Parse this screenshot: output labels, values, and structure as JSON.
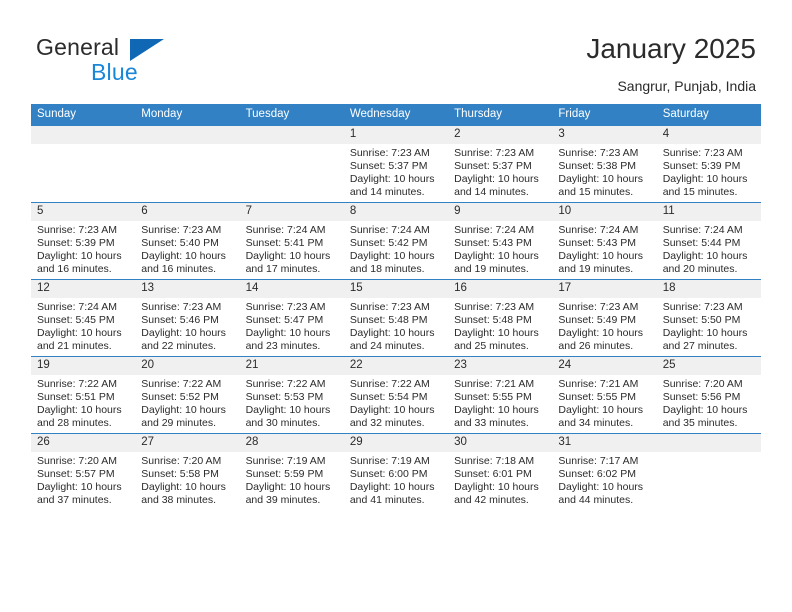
{
  "brand": {
    "name_part1": "General",
    "name_part2": "Blue",
    "accent_color": "#1a86d8",
    "triangle_color": "#1068b5"
  },
  "header": {
    "title": "January 2025",
    "subtitle": "Sangrur, Punjab, India"
  },
  "calendar": {
    "header_bg": "#3281c4",
    "daynum_bg": "#f0f0f0",
    "weekdays": [
      "Sunday",
      "Monday",
      "Tuesday",
      "Wednesday",
      "Thursday",
      "Friday",
      "Saturday"
    ],
    "labels": {
      "sunrise": "Sunrise:",
      "sunset": "Sunset:",
      "daylight": "Daylight:"
    },
    "weeks": [
      [
        {
          "day": "",
          "empty": true
        },
        {
          "day": "",
          "empty": true
        },
        {
          "day": "",
          "empty": true
        },
        {
          "day": "1",
          "sunrise": "Sunrise: 7:23 AM",
          "sunset": "Sunset: 5:37 PM",
          "daylight_line1": "Daylight: 10 hours",
          "daylight_line2": "and 14 minutes."
        },
        {
          "day": "2",
          "sunrise": "Sunrise: 7:23 AM",
          "sunset": "Sunset: 5:37 PM",
          "daylight_line1": "Daylight: 10 hours",
          "daylight_line2": "and 14 minutes."
        },
        {
          "day": "3",
          "sunrise": "Sunrise: 7:23 AM",
          "sunset": "Sunset: 5:38 PM",
          "daylight_line1": "Daylight: 10 hours",
          "daylight_line2": "and 15 minutes."
        },
        {
          "day": "4",
          "sunrise": "Sunrise: 7:23 AM",
          "sunset": "Sunset: 5:39 PM",
          "daylight_line1": "Daylight: 10 hours",
          "daylight_line2": "and 15 minutes."
        }
      ],
      [
        {
          "day": "5",
          "sunrise": "Sunrise: 7:23 AM",
          "sunset": "Sunset: 5:39 PM",
          "daylight_line1": "Daylight: 10 hours",
          "daylight_line2": "and 16 minutes."
        },
        {
          "day": "6",
          "sunrise": "Sunrise: 7:23 AM",
          "sunset": "Sunset: 5:40 PM",
          "daylight_line1": "Daylight: 10 hours",
          "daylight_line2": "and 16 minutes."
        },
        {
          "day": "7",
          "sunrise": "Sunrise: 7:24 AM",
          "sunset": "Sunset: 5:41 PM",
          "daylight_line1": "Daylight: 10 hours",
          "daylight_line2": "and 17 minutes."
        },
        {
          "day": "8",
          "sunrise": "Sunrise: 7:24 AM",
          "sunset": "Sunset: 5:42 PM",
          "daylight_line1": "Daylight: 10 hours",
          "daylight_line2": "and 18 minutes."
        },
        {
          "day": "9",
          "sunrise": "Sunrise: 7:24 AM",
          "sunset": "Sunset: 5:43 PM",
          "daylight_line1": "Daylight: 10 hours",
          "daylight_line2": "and 19 minutes."
        },
        {
          "day": "10",
          "sunrise": "Sunrise: 7:24 AM",
          "sunset": "Sunset: 5:43 PM",
          "daylight_line1": "Daylight: 10 hours",
          "daylight_line2": "and 19 minutes."
        },
        {
          "day": "11",
          "sunrise": "Sunrise: 7:24 AM",
          "sunset": "Sunset: 5:44 PM",
          "daylight_line1": "Daylight: 10 hours",
          "daylight_line2": "and 20 minutes."
        }
      ],
      [
        {
          "day": "12",
          "sunrise": "Sunrise: 7:24 AM",
          "sunset": "Sunset: 5:45 PM",
          "daylight_line1": "Daylight: 10 hours",
          "daylight_line2": "and 21 minutes."
        },
        {
          "day": "13",
          "sunrise": "Sunrise: 7:23 AM",
          "sunset": "Sunset: 5:46 PM",
          "daylight_line1": "Daylight: 10 hours",
          "daylight_line2": "and 22 minutes."
        },
        {
          "day": "14",
          "sunrise": "Sunrise: 7:23 AM",
          "sunset": "Sunset: 5:47 PM",
          "daylight_line1": "Daylight: 10 hours",
          "daylight_line2": "and 23 minutes."
        },
        {
          "day": "15",
          "sunrise": "Sunrise: 7:23 AM",
          "sunset": "Sunset: 5:48 PM",
          "daylight_line1": "Daylight: 10 hours",
          "daylight_line2": "and 24 minutes."
        },
        {
          "day": "16",
          "sunrise": "Sunrise: 7:23 AM",
          "sunset": "Sunset: 5:48 PM",
          "daylight_line1": "Daylight: 10 hours",
          "daylight_line2": "and 25 minutes."
        },
        {
          "day": "17",
          "sunrise": "Sunrise: 7:23 AM",
          "sunset": "Sunset: 5:49 PM",
          "daylight_line1": "Daylight: 10 hours",
          "daylight_line2": "and 26 minutes."
        },
        {
          "day": "18",
          "sunrise": "Sunrise: 7:23 AM",
          "sunset": "Sunset: 5:50 PM",
          "daylight_line1": "Daylight: 10 hours",
          "daylight_line2": "and 27 minutes."
        }
      ],
      [
        {
          "day": "19",
          "sunrise": "Sunrise: 7:22 AM",
          "sunset": "Sunset: 5:51 PM",
          "daylight_line1": "Daylight: 10 hours",
          "daylight_line2": "and 28 minutes."
        },
        {
          "day": "20",
          "sunrise": "Sunrise: 7:22 AM",
          "sunset": "Sunset: 5:52 PM",
          "daylight_line1": "Daylight: 10 hours",
          "daylight_line2": "and 29 minutes."
        },
        {
          "day": "21",
          "sunrise": "Sunrise: 7:22 AM",
          "sunset": "Sunset: 5:53 PM",
          "daylight_line1": "Daylight: 10 hours",
          "daylight_line2": "and 30 minutes."
        },
        {
          "day": "22",
          "sunrise": "Sunrise: 7:22 AM",
          "sunset": "Sunset: 5:54 PM",
          "daylight_line1": "Daylight: 10 hours",
          "daylight_line2": "and 32 minutes."
        },
        {
          "day": "23",
          "sunrise": "Sunrise: 7:21 AM",
          "sunset": "Sunset: 5:55 PM",
          "daylight_line1": "Daylight: 10 hours",
          "daylight_line2": "and 33 minutes."
        },
        {
          "day": "24",
          "sunrise": "Sunrise: 7:21 AM",
          "sunset": "Sunset: 5:55 PM",
          "daylight_line1": "Daylight: 10 hours",
          "daylight_line2": "and 34 minutes."
        },
        {
          "day": "25",
          "sunrise": "Sunrise: 7:20 AM",
          "sunset": "Sunset: 5:56 PM",
          "daylight_line1": "Daylight: 10 hours",
          "daylight_line2": "and 35 minutes."
        }
      ],
      [
        {
          "day": "26",
          "sunrise": "Sunrise: 7:20 AM",
          "sunset": "Sunset: 5:57 PM",
          "daylight_line1": "Daylight: 10 hours",
          "daylight_line2": "and 37 minutes."
        },
        {
          "day": "27",
          "sunrise": "Sunrise: 7:20 AM",
          "sunset": "Sunset: 5:58 PM",
          "daylight_line1": "Daylight: 10 hours",
          "daylight_line2": "and 38 minutes."
        },
        {
          "day": "28",
          "sunrise": "Sunrise: 7:19 AM",
          "sunset": "Sunset: 5:59 PM",
          "daylight_line1": "Daylight: 10 hours",
          "daylight_line2": "and 39 minutes."
        },
        {
          "day": "29",
          "sunrise": "Sunrise: 7:19 AM",
          "sunset": "Sunset: 6:00 PM",
          "daylight_line1": "Daylight: 10 hours",
          "daylight_line2": "and 41 minutes."
        },
        {
          "day": "30",
          "sunrise": "Sunrise: 7:18 AM",
          "sunset": "Sunset: 6:01 PM",
          "daylight_line1": "Daylight: 10 hours",
          "daylight_line2": "and 42 minutes."
        },
        {
          "day": "31",
          "sunrise": "Sunrise: 7:17 AM",
          "sunset": "Sunset: 6:02 PM",
          "daylight_line1": "Daylight: 10 hours",
          "daylight_line2": "and 44 minutes."
        },
        {
          "day": "",
          "empty": true
        }
      ]
    ]
  }
}
